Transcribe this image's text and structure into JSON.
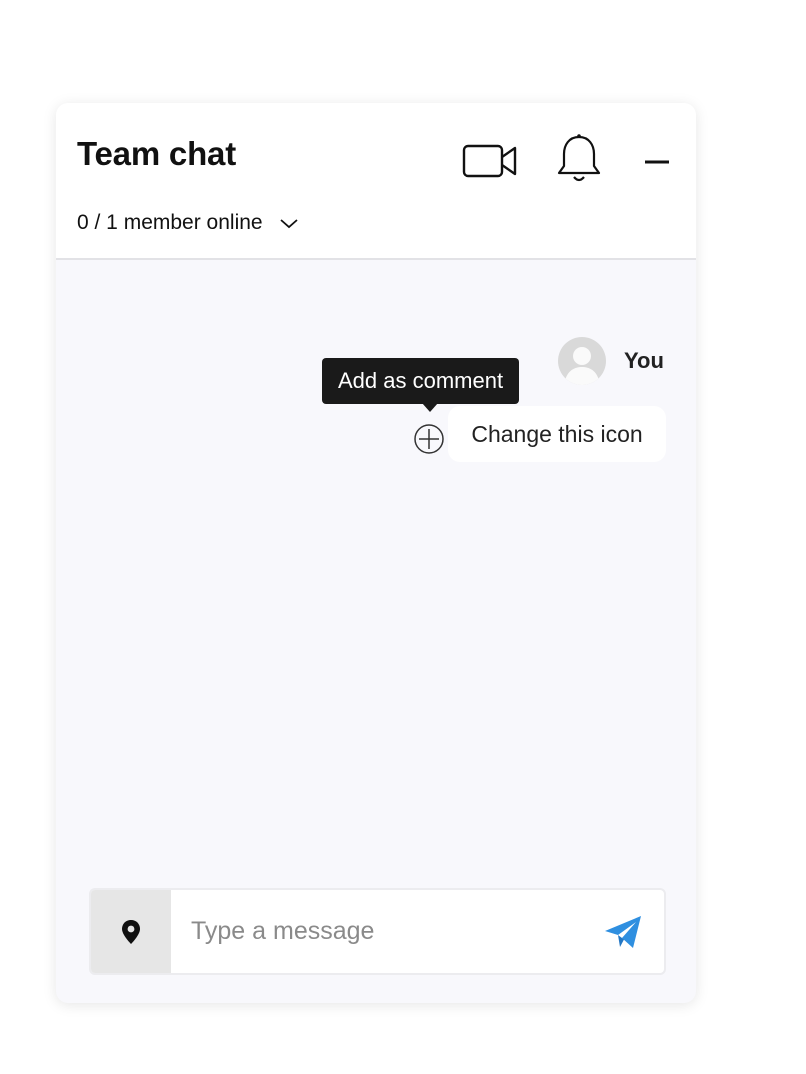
{
  "chat": {
    "title": "Team chat",
    "members_online": "0 / 1 member online",
    "icons": {
      "video": "video-camera-icon",
      "notifications": "bell-icon",
      "minimize": "minus-icon",
      "members_toggle": "chevron-down-icon"
    }
  },
  "message": {
    "author": "You",
    "text": "Change this icon",
    "tooltip": "Add as comment",
    "add_comment_icon": "plus-circle-icon"
  },
  "composer": {
    "placeholder": "Type a message",
    "location_icon": "map-pin-icon",
    "send_icon": "paper-plane-icon"
  },
  "colors": {
    "send_accent": "#2f8fe0",
    "tooltip_bg": "#1a1a1a",
    "panel_bg": "#f8f8fc"
  }
}
